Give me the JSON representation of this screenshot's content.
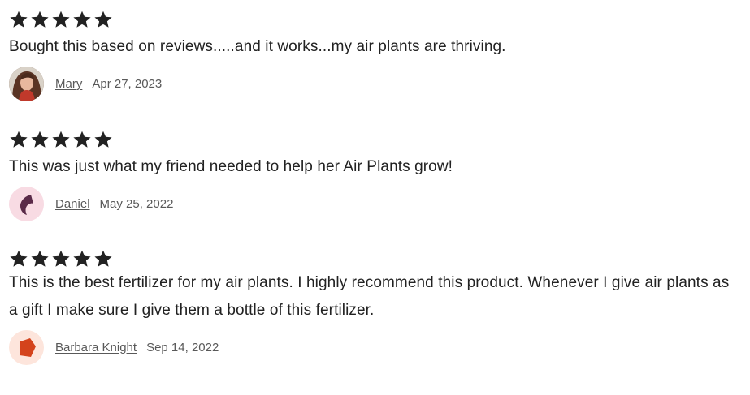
{
  "reviews": [
    {
      "rating": 5,
      "text": "Bought this based on reviews.....and it works...my air plants are thriving.",
      "reviewer": "Mary",
      "date": "Apr 27, 2023",
      "avatar": "photo"
    },
    {
      "rating": 5,
      "text": "This was just what my friend needed to help her Air Plants grow!",
      "reviewer": "Daniel",
      "date": "May 25, 2022",
      "avatar": "default-pink"
    },
    {
      "rating": 5,
      "text": "This is the best fertilizer for my air plants. I highly recommend this product. Whenever I give air plants as a gift I make sure I give them a bottle of this fertilizer.",
      "reviewer": "Barbara Knight",
      "date": "Sep 14, 2022",
      "avatar": "default-orange"
    }
  ],
  "icons": {
    "star": "star-icon"
  },
  "colors": {
    "text": "#222222",
    "meta": "#595959",
    "star": "#222222",
    "avatar_pink_bg": "#f8dbe3",
    "avatar_pink_shape": "#5a2a48",
    "avatar_orange_bg": "#fde5dc",
    "avatar_orange_shape": "#d4431c"
  }
}
